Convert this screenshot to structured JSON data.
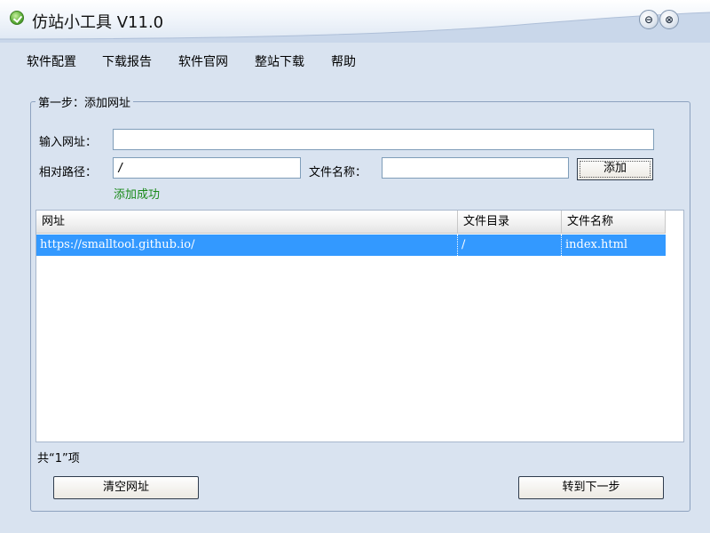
{
  "window": {
    "title": "仿站小工具 V11.0",
    "min_glyph": "⊖",
    "close_glyph": "⊗"
  },
  "menu": [
    "软件配置",
    "下载报告",
    "软件官网",
    "整站下载",
    "帮助"
  ],
  "step": {
    "group_label": "第一步：添加网址",
    "url_label": "输入网址：",
    "url_value": "",
    "path_label": "相对路径：",
    "path_value": "/",
    "filename_label": "文件名称：",
    "filename_value": "",
    "add_button": "添加",
    "status": "添加成功"
  },
  "table": {
    "columns": [
      "网址",
      "文件目录",
      "文件名称"
    ],
    "rows": [
      {
        "url": "https://smalltool.github.io/",
        "dir": "/",
        "file": "index.html"
      }
    ]
  },
  "footer": {
    "count_text": "共“1”项",
    "clear_button": "清空网址",
    "next_button": "转到下一步"
  },
  "colors": {
    "selection": "#3399ff",
    "success": "#1a8a1a",
    "background": "#d9e3f0"
  }
}
